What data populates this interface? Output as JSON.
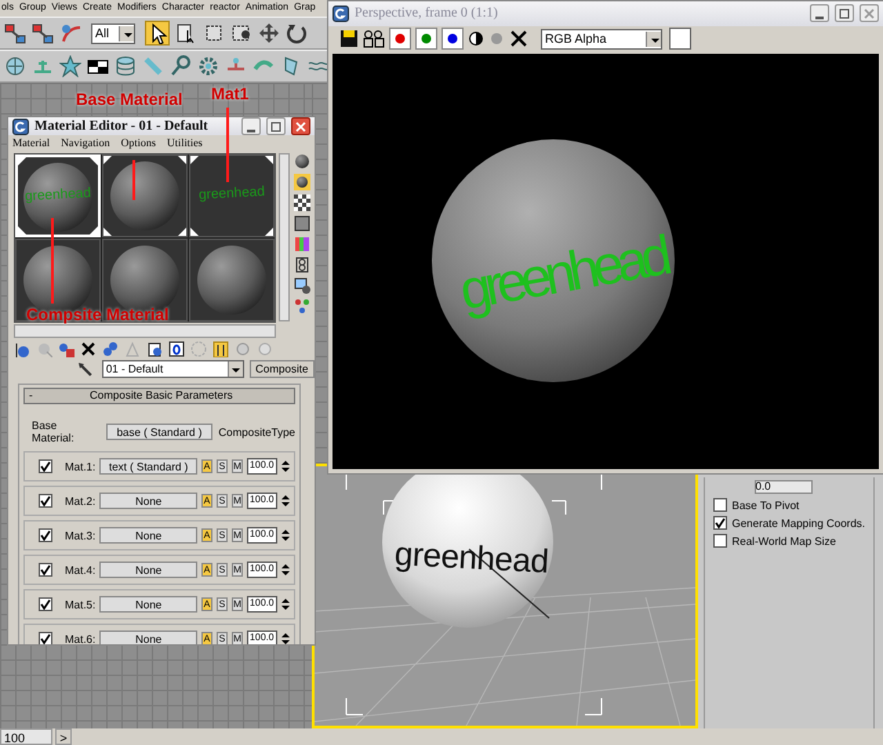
{
  "menu_bar": [
    "ols",
    "Group",
    "Views",
    "Create",
    "Modifiers",
    "Character",
    "reactor",
    "Animation",
    "Grap"
  ],
  "main_toolbar": {
    "selection_filter": "All"
  },
  "material_editor": {
    "title": "Material Editor - 01 - Default",
    "menu": [
      "Material",
      "Navigation",
      "Options",
      "Utilities"
    ],
    "slots": [
      {
        "kind": "sphere",
        "label": "greenhead",
        "selected": true,
        "hot": true
      },
      {
        "kind": "sphere",
        "selected": false,
        "hot": true
      },
      {
        "kind": "blank",
        "label": "greenhead",
        "selected": false,
        "hot": true
      },
      {
        "kind": "sphere",
        "selected": false,
        "hot": false
      },
      {
        "kind": "sphere",
        "selected": false,
        "hot": false
      },
      {
        "kind": "sphere",
        "selected": false,
        "hot": false
      }
    ],
    "material_name": "01 - Default",
    "material_type": "Composite",
    "rollout": {
      "expander": "-",
      "title": "Composite Basic Parameters",
      "base_label": "Base Material:",
      "base_value": "base  ( Standard )",
      "composite_type": "CompositeType",
      "mats": [
        {
          "label": "Mat.1:",
          "checked": true,
          "value": "text  ( Standard )",
          "modes": [
            {
              "label": "A",
              "selected": true
            },
            {
              "label": "S",
              "selected": false
            },
            {
              "label": "M",
              "selected": false
            }
          ],
          "amount": "100.0"
        },
        {
          "label": "Mat.2:",
          "checked": true,
          "value": "None",
          "modes": [
            {
              "label": "A",
              "selected": true
            },
            {
              "label": "S",
              "selected": false
            },
            {
              "label": "M",
              "selected": false
            }
          ],
          "amount": "100.0"
        },
        {
          "label": "Mat.3:",
          "checked": true,
          "value": "None",
          "modes": [
            {
              "label": "A",
              "selected": true
            },
            {
              "label": "S",
              "selected": false
            },
            {
              "label": "M",
              "selected": false
            }
          ],
          "amount": "100.0"
        },
        {
          "label": "Mat.4:",
          "checked": true,
          "value": "None",
          "modes": [
            {
              "label": "A",
              "selected": true
            },
            {
              "label": "S",
              "selected": false
            },
            {
              "label": "M",
              "selected": false
            }
          ],
          "amount": "100.0"
        },
        {
          "label": "Mat.5:",
          "checked": true,
          "value": "None",
          "modes": [
            {
              "label": "A",
              "selected": true
            },
            {
              "label": "S",
              "selected": false
            },
            {
              "label": "M",
              "selected": false
            }
          ],
          "amount": "100.0"
        },
        {
          "label": "Mat.6:",
          "checked": true,
          "value": "None",
          "modes": [
            {
              "label": "A",
              "selected": true
            },
            {
              "label": "S",
              "selected": false
            },
            {
              "label": "M",
              "selected": false
            }
          ],
          "amount": "100.0"
        }
      ]
    }
  },
  "render_window": {
    "title": "Perspective, frame 0 (1:1)",
    "channel": "RGB Alpha",
    "render_text": "greenhead"
  },
  "viewport": {
    "object_text": "greenhead"
  },
  "modifier_panel": {
    "slice_value": "0.0",
    "options": [
      {
        "label": "Base To Pivot",
        "checked": false
      },
      {
        "label": "Generate Mapping Coords.",
        "checked": true
      },
      {
        "label": "Real-World Map Size",
        "checked": false
      }
    ]
  },
  "annotations": [
    {
      "text": "Base Material"
    },
    {
      "text": "Mat1"
    },
    {
      "text": "Compsite Material"
    }
  ],
  "status_bar": {
    "frame": "100",
    "arrow": ">"
  }
}
